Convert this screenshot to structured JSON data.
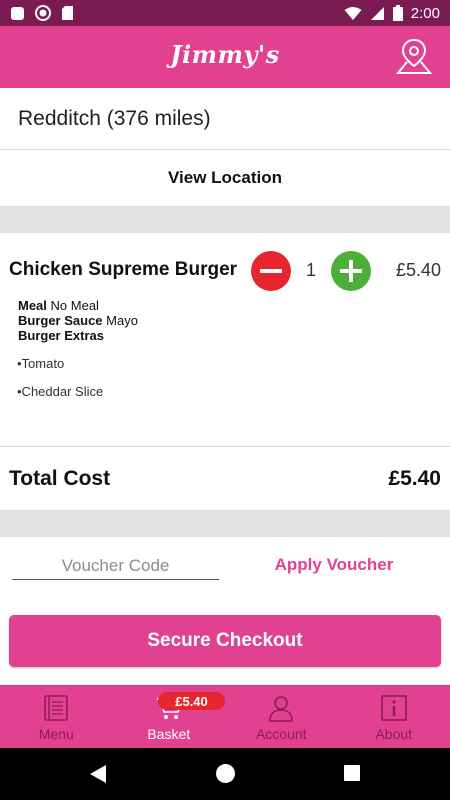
{
  "status_bar": {
    "time": "2:00"
  },
  "app_bar": {
    "logo_text": "Jimmy's",
    "location_icon": "map-pin-icon"
  },
  "store": {
    "location_label": "Redditch (376 miles)",
    "view_location_label": "View Location"
  },
  "basket": {
    "items": [
      {
        "name": "Chicken Supreme Burger",
        "quantity": "1",
        "price": "£5.40",
        "options": [
          {
            "label": "Meal",
            "value": "No Meal"
          },
          {
            "label": "Burger Sauce",
            "value": "Mayo"
          },
          {
            "label": "Burger Extras",
            "value": ""
          }
        ],
        "extras": [
          "•Tomato",
          "•Cheddar Slice"
        ]
      }
    ],
    "total_label": "Total Cost",
    "total_value": "£5.40"
  },
  "voucher": {
    "placeholder": "Voucher Code",
    "apply_label": "Apply Voucher"
  },
  "checkout_label": "Secure Checkout",
  "bottom_nav": {
    "items": [
      {
        "label": "Menu",
        "icon": "menu-book-icon",
        "active": false
      },
      {
        "label": "Basket",
        "icon": "cart-icon",
        "active": true
      },
      {
        "label": "Account",
        "icon": "person-icon",
        "active": false
      },
      {
        "label": "About",
        "icon": "info-icon",
        "active": false
      }
    ],
    "basket_badge": "£5.40"
  },
  "colors": {
    "brand_pink": "#e2418f",
    "status_bar": "#7a1b52",
    "minus_red": "#e5262f",
    "plus_green": "#4caf3a",
    "separator_gray": "#e4e4e4"
  }
}
